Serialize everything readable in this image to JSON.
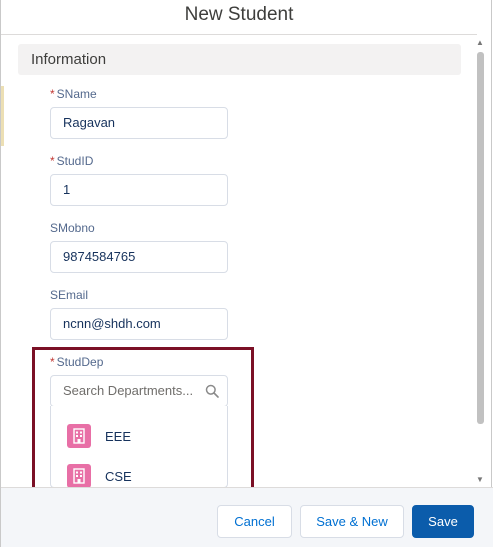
{
  "modal": {
    "title": "New Student",
    "section": "Information"
  },
  "fields": {
    "sname": {
      "label": "SName",
      "required": true,
      "value": "Ragavan"
    },
    "studid": {
      "label": "StudID",
      "required": true,
      "value": "1"
    },
    "smobno": {
      "label": "SMobno",
      "required": false,
      "value": "9874584765"
    },
    "semail": {
      "label": "SEmail",
      "required": false,
      "value": "ncnn@shdh.com"
    },
    "studdep": {
      "label": "StudDep",
      "required": true,
      "placeholder": "Search Departments..."
    }
  },
  "lookup": {
    "options": [
      {
        "label": "EEE",
        "icon": "building-icon"
      },
      {
        "label": "CSE",
        "icon": "building-icon"
      }
    ]
  },
  "footer": {
    "cancel": "Cancel",
    "save_new": "Save & New",
    "save": "Save"
  },
  "colors": {
    "required": "#c23934",
    "brand": "#0b5cab",
    "highlight": "#7b1026",
    "option_icon": "#e86fa6"
  }
}
